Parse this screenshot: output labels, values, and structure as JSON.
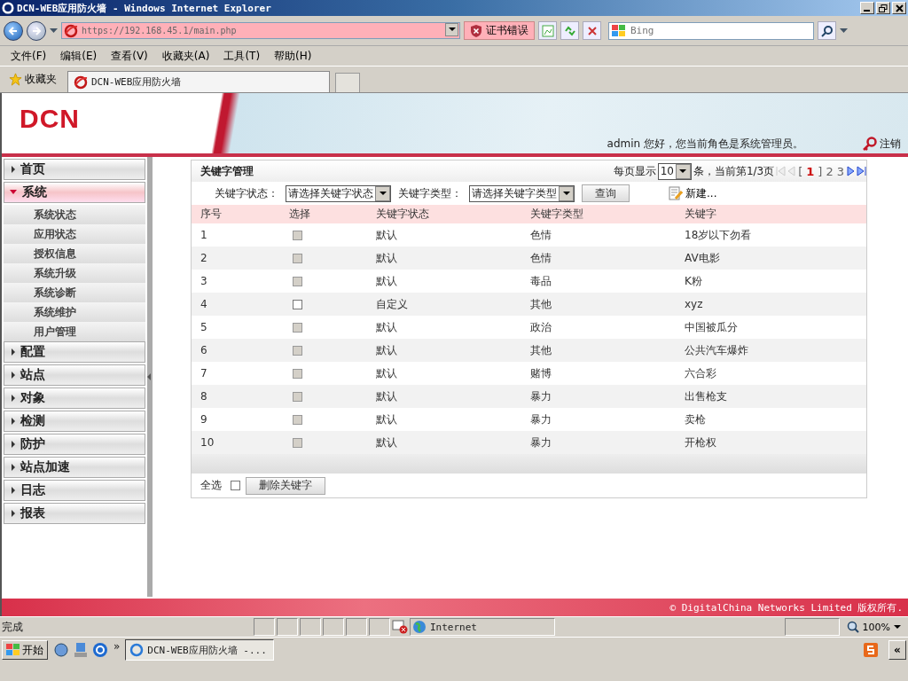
{
  "window": {
    "title": "DCN-WEB应用防火墙 - Windows Internet Explorer"
  },
  "address_bar": {
    "value": "https://192.168.45.1/main.php",
    "cert_error": "证书错误"
  },
  "search": {
    "placeholder": "Bing"
  },
  "menu": [
    "文件(F)",
    "编辑(E)",
    "查看(V)",
    "收藏夹(A)",
    "工具(T)",
    "帮助(H)"
  ],
  "favorites": {
    "label": "收藏夹"
  },
  "tabs": [
    {
      "label": "DCN-WEB应用防火墙",
      "selected": true
    }
  ],
  "header": {
    "logo": "DCN",
    "greeting": "admin 您好，您当前角色是系统管理员。",
    "logout": "注销"
  },
  "sidebar": {
    "items": [
      {
        "label": "首页",
        "expanded": false
      },
      {
        "label": "系统",
        "expanded": true,
        "children": [
          {
            "label": "系统状态"
          },
          {
            "label": "应用状态"
          },
          {
            "label": "授权信息"
          },
          {
            "label": "系统升级"
          },
          {
            "label": "系统诊断"
          },
          {
            "label": "系统维护"
          },
          {
            "label": "用户管理"
          }
        ]
      },
      {
        "label": "配置",
        "expanded": false
      },
      {
        "label": "站点",
        "expanded": false
      },
      {
        "label": "对象",
        "expanded": false
      },
      {
        "label": "检测",
        "expanded": false
      },
      {
        "label": "防护",
        "expanded": false
      },
      {
        "label": "站点加速",
        "expanded": false
      },
      {
        "label": "日志",
        "expanded": false
      },
      {
        "label": "报表",
        "expanded": false
      }
    ]
  },
  "panel": {
    "title": "关键字管理",
    "pagination": {
      "per_page_label": "每页显示",
      "per_page": "10",
      "summary": "条，当前第1/3页",
      "open_bracket": "[",
      "close_bracket": "]",
      "pages": [
        {
          "label": "1",
          "selected": true
        },
        {
          "label": "2",
          "selected": false
        },
        {
          "label": "3",
          "selected": false
        }
      ]
    },
    "filters": [
      {
        "label": "关键字状态：",
        "value": "请选择关键字状态"
      },
      {
        "label": "关键字类型：",
        "value": "请选择关键字类型"
      }
    ],
    "query_button": "查询",
    "new_button": "新建...",
    "table": {
      "columns": [
        "序号",
        "选择",
        "关键字状态",
        "关键字类型",
        "关键字"
      ],
      "rows": [
        {
          "index": "1",
          "disabled": true,
          "status": "默认",
          "type": "色情",
          "keyword": "18岁以下勿看"
        },
        {
          "index": "2",
          "disabled": true,
          "status": "默认",
          "type": "色情",
          "keyword": "AV电影"
        },
        {
          "index": "3",
          "disabled": true,
          "status": "默认",
          "type": "毒品",
          "keyword": "K粉"
        },
        {
          "index": "4",
          "disabled": false,
          "status": "自定义",
          "type": "其他",
          "keyword": "xyz"
        },
        {
          "index": "5",
          "disabled": true,
          "status": "默认",
          "type": "政治",
          "keyword": "中国被瓜分"
        },
        {
          "index": "6",
          "disabled": true,
          "status": "默认",
          "type": "其他",
          "keyword": "公共汽车爆炸"
        },
        {
          "index": "7",
          "disabled": true,
          "status": "默认",
          "type": "赌博",
          "keyword": "六合彩"
        },
        {
          "index": "8",
          "disabled": true,
          "status": "默认",
          "type": "暴力",
          "keyword": "出售枪支"
        },
        {
          "index": "9",
          "disabled": true,
          "status": "默认",
          "type": "暴力",
          "keyword": "卖枪"
        },
        {
          "index": "10",
          "disabled": true,
          "status": "默认",
          "type": "暴力",
          "keyword": "开枪权"
        }
      ]
    },
    "select_all": {
      "label": "全选",
      "checked": false
    },
    "delete_button": "删除关键字"
  },
  "footer": "© DigitalChina Networks Limited 版权所有.",
  "status_bar": {
    "text": "完成",
    "zone": "Internet",
    "zoom": "100%"
  },
  "taskbar": {
    "start": "开始",
    "more": "»",
    "task": "DCN-WEB应用防火墙 -...",
    "collapse": "«"
  }
}
